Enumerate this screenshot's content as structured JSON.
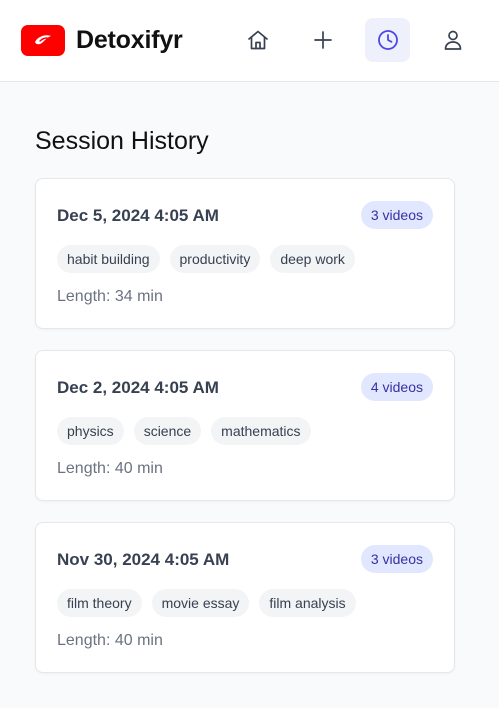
{
  "app": {
    "name": "Detoxifyr",
    "brand_color": "#ff0000"
  },
  "nav": [
    {
      "icon": "home-icon",
      "active": false
    },
    {
      "icon": "plus-icon",
      "active": false
    },
    {
      "icon": "clock-icon",
      "active": true
    },
    {
      "icon": "user-icon",
      "active": false
    }
  ],
  "page": {
    "title": "Session History"
  },
  "sessions": [
    {
      "date": "Dec 5, 2024 4:05 AM",
      "videos": "3 videos",
      "tags": [
        "habit building",
        "productivity",
        "deep work"
      ],
      "length": "Length: 34 min"
    },
    {
      "date": "Dec 2, 2024 4:05 AM",
      "videos": "4 videos",
      "tags": [
        "physics",
        "science",
        "mathematics"
      ],
      "length": "Length: 40 min"
    },
    {
      "date": "Nov 30, 2024 4:05 AM",
      "videos": "3 videos",
      "tags": [
        "film theory",
        "movie essay",
        "film analysis"
      ],
      "length": "Length: 40 min"
    }
  ],
  "colors": {
    "accent": "#4f46e5",
    "badge_bg": "#e0e7ff",
    "badge_text": "#3730a3",
    "tag_bg": "#f3f4f6"
  }
}
